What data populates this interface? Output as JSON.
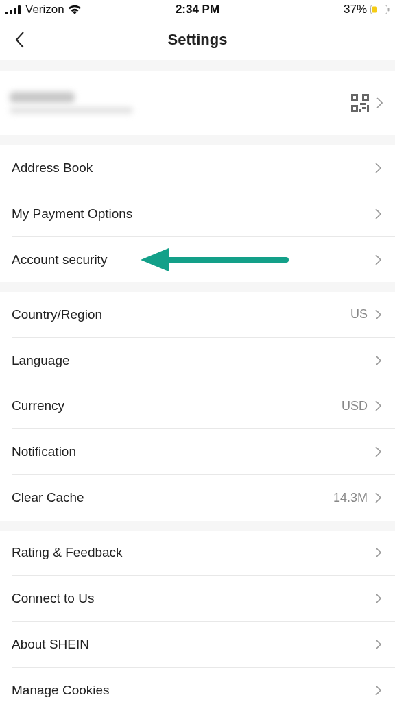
{
  "status_bar": {
    "carrier": "Verizon",
    "time": "2:34 PM",
    "battery": "37%"
  },
  "header": {
    "title": "Settings"
  },
  "sections": [
    {
      "rows": [
        {
          "label": "Address Book"
        },
        {
          "label": "My Payment Options"
        },
        {
          "label": "Account security",
          "highlighted": true
        }
      ]
    },
    {
      "rows": [
        {
          "label": "Country/Region",
          "value": "US"
        },
        {
          "label": "Language"
        },
        {
          "label": "Currency",
          "value": "USD"
        },
        {
          "label": "Notification"
        },
        {
          "label": "Clear Cache",
          "value": "14.3M"
        }
      ]
    },
    {
      "rows": [
        {
          "label": "Rating & Feedback"
        },
        {
          "label": "Connect to Us"
        },
        {
          "label": "About SHEIN"
        },
        {
          "label": "Manage Cookies"
        }
      ]
    }
  ]
}
